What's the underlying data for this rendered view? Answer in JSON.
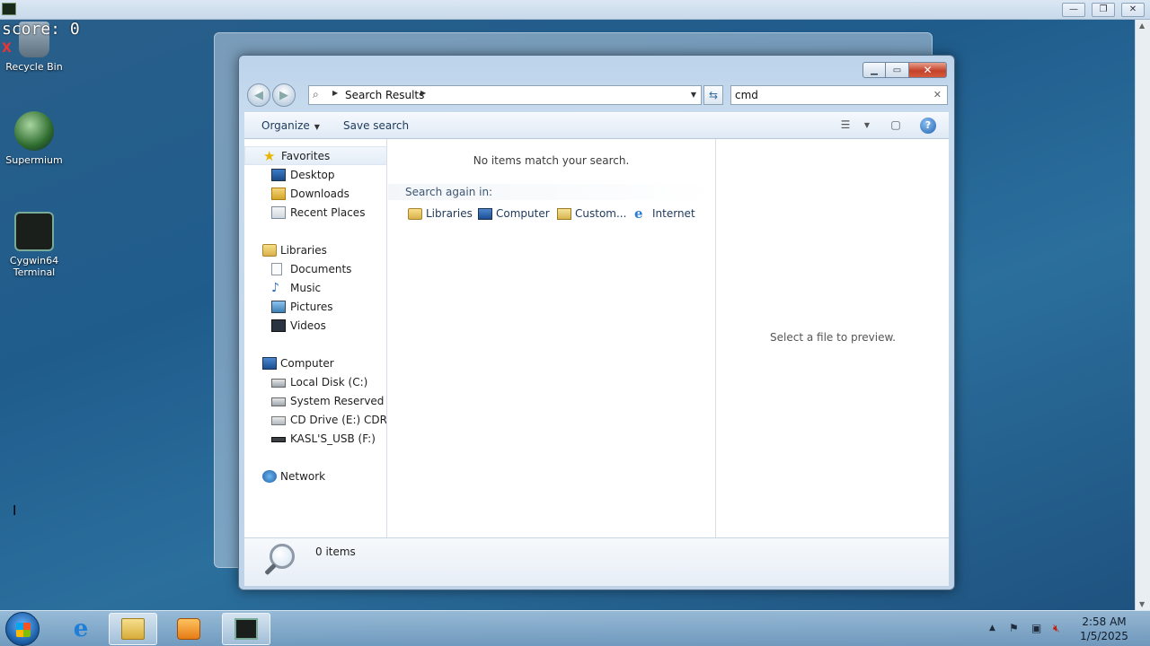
{
  "overlay": {
    "score": "score: 0",
    "mark": "X"
  },
  "desktop": {
    "icons": [
      {
        "label": "Recycle Bin"
      },
      {
        "label": "Supermium"
      },
      {
        "label": "Cygwin64 Terminal"
      }
    ]
  },
  "window": {
    "breadcrumb": "Search Results",
    "search_value": "cmd",
    "toolbar": {
      "organize": "Organize",
      "save_search": "Save search"
    },
    "nav": {
      "favorites": "Favorites",
      "desktop": "Desktop",
      "downloads": "Downloads",
      "recent_places": "Recent Places",
      "libraries": "Libraries",
      "documents": "Documents",
      "music": "Music",
      "pictures": "Pictures",
      "videos": "Videos",
      "computer": "Computer",
      "local_disk": "Local Disk (C:)",
      "system_reserved": "System Reserved (D:",
      "cd_drive": "CD Drive (E:) CDROM",
      "usb": "KASL'S_USB (F:)",
      "network": "Network"
    },
    "results": {
      "empty_message": "No items match your search.",
      "search_again_label": "Search again in:",
      "locations": [
        "Libraries",
        "Computer",
        "Custom...",
        "Internet"
      ]
    },
    "preview_message": "Select a file to preview.",
    "details": {
      "count": "0 items"
    }
  },
  "taskbar": {
    "clock_time": "2:58 AM",
    "clock_date": "1/5/2025"
  }
}
